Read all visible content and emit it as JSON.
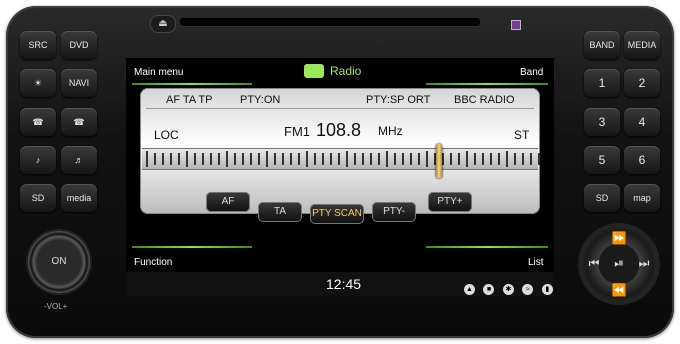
{
  "top": {
    "eject_icon": "eject-icon"
  },
  "left_buttons": [
    "SRC",
    "DVD",
    "☀",
    "NAVI",
    "☎",
    "☎",
    "♪",
    "♬",
    "SD",
    "media"
  ],
  "right_buttons": [
    "BAND",
    "MEDIA",
    "1",
    "2",
    "3",
    "4",
    "5",
    "6",
    "SD",
    "map"
  ],
  "screen": {
    "main_menu": "Main menu",
    "title": "Radio",
    "band": "Band",
    "info": {
      "af_ta_tp": "AF TA TP",
      "pty_on": "PTY:ON",
      "pty_sport": "PTY:SP ORT",
      "station": "BBC RADIO"
    },
    "loc": "LOC",
    "band_name": "FM1",
    "frequency": "108.8",
    "unit": "MHz",
    "st": "ST",
    "tuner_position": 0.75,
    "buttons": [
      {
        "label": "AF"
      },
      {
        "label": "TA"
      },
      {
        "label": "PTY SCAN"
      },
      {
        "label": "PTY-"
      },
      {
        "label": "PTY+"
      }
    ],
    "function": "Function",
    "list": "List",
    "time": "12:45"
  },
  "knob": {
    "on": "ON",
    "vol": "-VOL+"
  },
  "colors": {
    "accent": "#8be34b",
    "active": "#f3c86a"
  }
}
